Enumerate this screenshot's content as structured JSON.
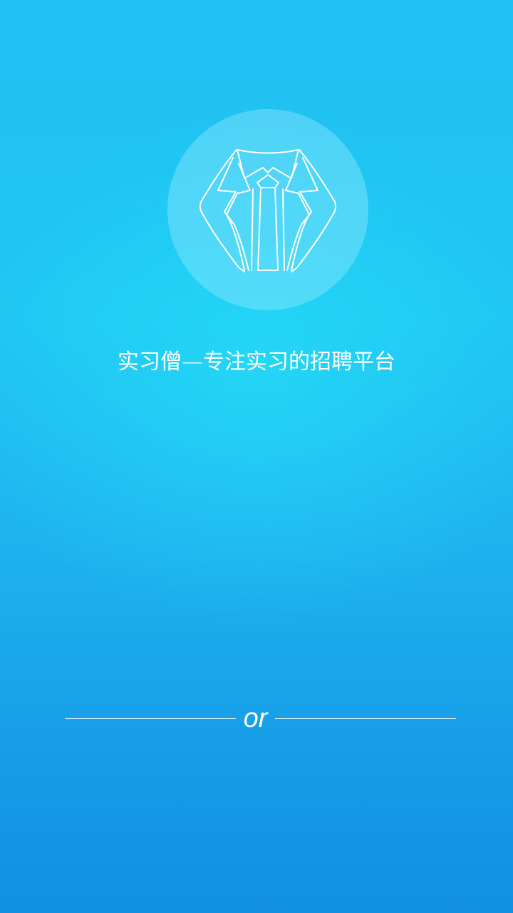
{
  "splash": {
    "logo_icon": "suit-shirt-tie-icon",
    "slogan": "实习僧—专注实习的招聘平台",
    "divider_text": "or"
  },
  "colors": {
    "background_top": "#20c0f2",
    "background_bottom": "#1190e2",
    "accent_glow": "#28e6fa",
    "text": "#ffffff"
  }
}
